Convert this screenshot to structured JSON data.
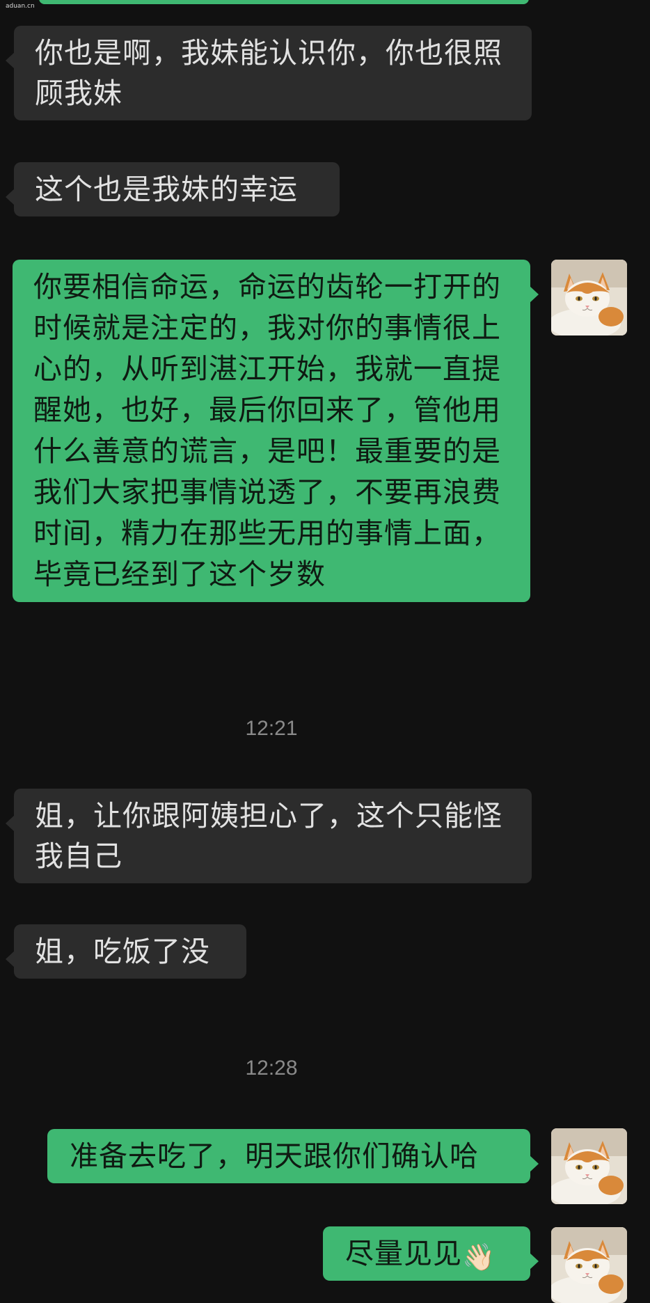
{
  "watermark": "aduan.cn",
  "messages": [
    {
      "side": "in",
      "text": "你也是啊，我妹能认识你，你也很照顾我妹"
    },
    {
      "side": "in",
      "text": "这个也是我妹的幸运"
    },
    {
      "side": "out",
      "text": "你要相信命运，命运的齿轮一打开的时候就是注定的，我对你的事情很上心的，从听到湛江开始，我就一直提醒她，也好，最后你回来了，管他用什么善意的谎言，是吧！最重要的是我们大家把事情说透了，不要再浪费时间，精力在那些无用的事情上面，毕竟已经到了这个岁数"
    },
    {
      "side": "in",
      "text": "姐，让你跟阿姨担心了，这个只能怪我自己"
    },
    {
      "side": "in",
      "text": "姐，吃饭了没"
    },
    {
      "side": "out",
      "text": "准备去吃了，明天跟你们确认哈"
    },
    {
      "side": "out",
      "text": "尽量见见",
      "emoji": "👋🏻"
    }
  ],
  "timestamps": [
    "12:21",
    "12:28"
  ],
  "avatar_icon": "cat-avatar-icon",
  "colors": {
    "background": "#111111",
    "incoming_bubble": "#2c2c2c",
    "outgoing_bubble": "#3fb872",
    "incoming_text": "#e2e2e2",
    "outgoing_text": "#0f1a12",
    "timestamp": "#8a8a8a"
  }
}
